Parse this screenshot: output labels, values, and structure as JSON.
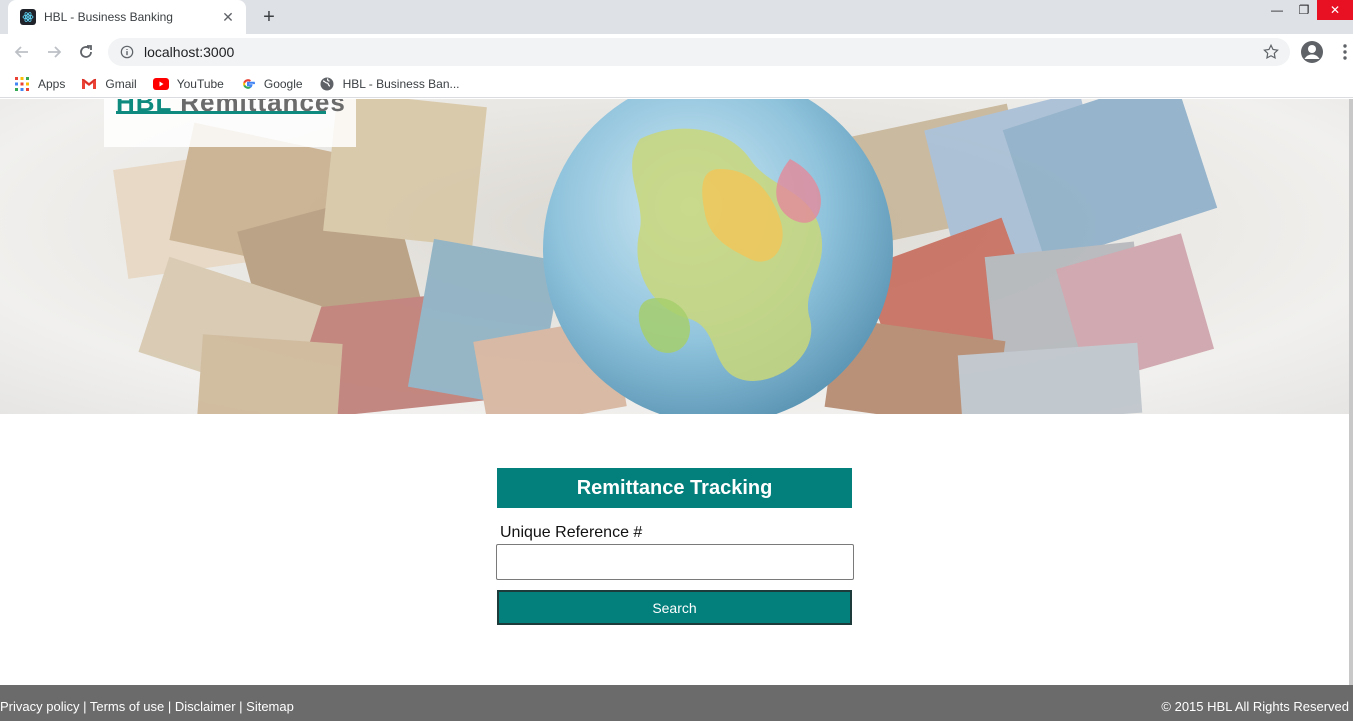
{
  "browser": {
    "tab_title": "HBL - Business Banking",
    "url": "localhost:3000",
    "bookmarks": [
      {
        "label": "Apps",
        "icon": "apps-grid-icon"
      },
      {
        "label": "Gmail",
        "icon": "gmail-icon"
      },
      {
        "label": "YouTube",
        "icon": "youtube-icon"
      },
      {
        "label": "Google",
        "icon": "google-icon"
      },
      {
        "label": "HBL - Business Ban...",
        "icon": "globe-icon"
      }
    ]
  },
  "hero": {
    "logo_brand": "HBL",
    "logo_text": "Remittances"
  },
  "tracking": {
    "heading": "Remittance Tracking",
    "field_label": "Unique Reference #",
    "input_value": "",
    "search_label": "Search"
  },
  "footer": {
    "links": [
      "Privacy policy",
      "Terms of use",
      "Disclaimer",
      "Sitemap"
    ],
    "separator": " | ",
    "copyright": "© 2015 HBL All Rights Reserved"
  },
  "colors": {
    "accent": "#037f7c",
    "footer_bg": "#6b6b6b"
  }
}
